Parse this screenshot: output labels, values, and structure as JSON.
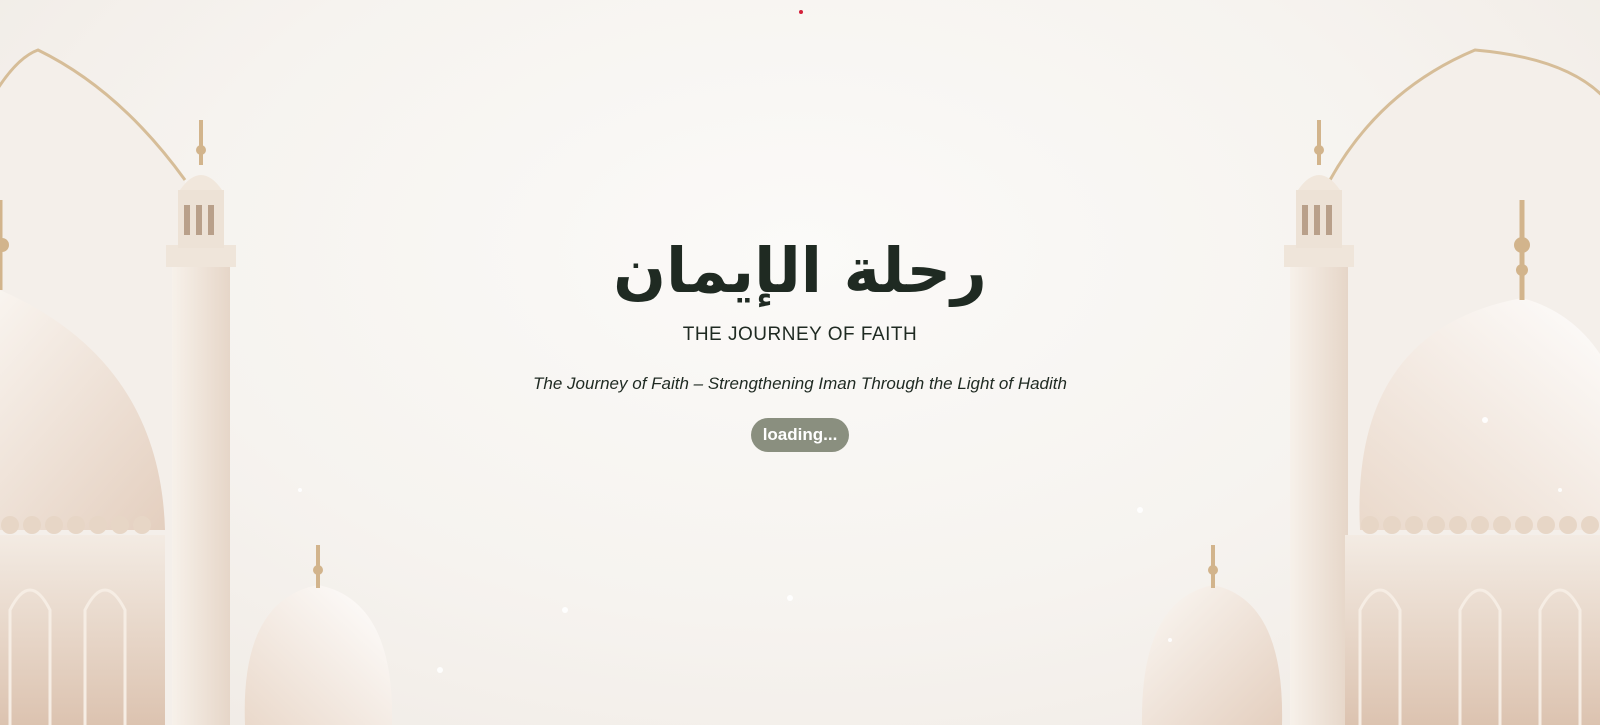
{
  "page": {
    "arabic_title": "رحلة الإيمان",
    "english_title": "THE JOURNEY OF FAITH",
    "tagline": "The Journey of Faith – Strengthening Iman Through the Light of Hadith",
    "loading_label": "loading..."
  },
  "background": {
    "illustration": "mosque-domes-and-minarets",
    "colors": {
      "base": "#f6f3ef",
      "dome": "#efe3d8",
      "gold": "#d2b48c",
      "text": "#1f2a22",
      "badge": "#8a8f7f"
    }
  }
}
